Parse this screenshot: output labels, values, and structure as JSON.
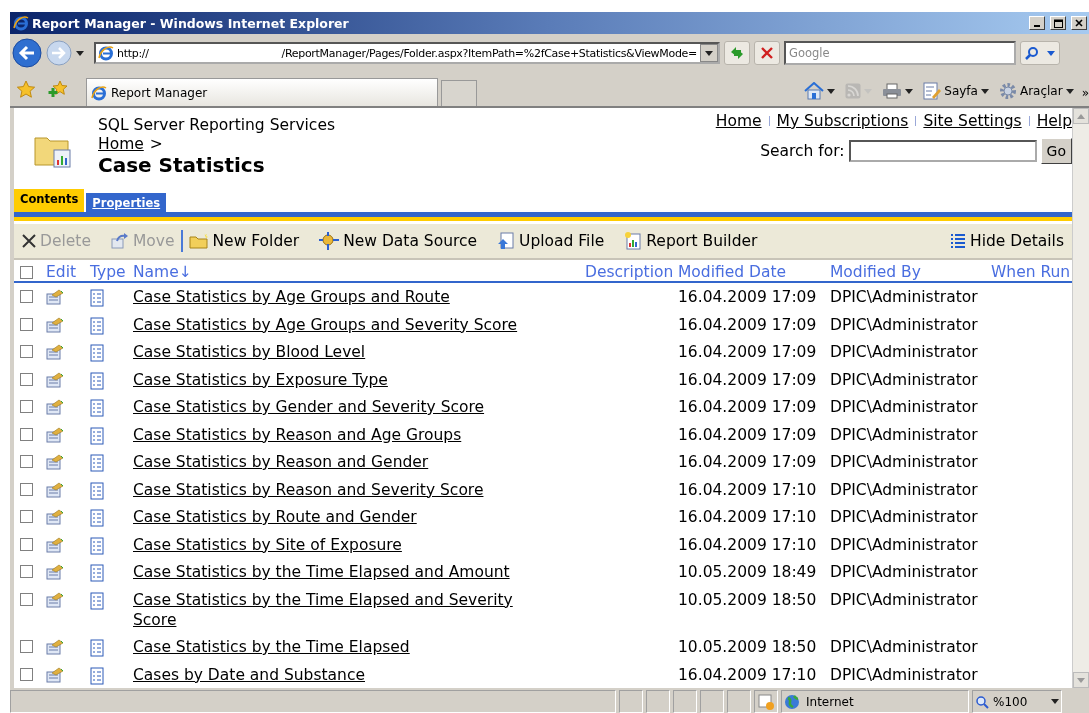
{
  "window": {
    "title": "Report Manager - Windows Internet Explorer"
  },
  "address_bar": {
    "url_scheme": "http://",
    "url_path": "/ReportManager/Pages/Folder.aspx?ItemPath=%2fCase+Statistics&ViewMode="
  },
  "search_box": {
    "placeholder": "Google"
  },
  "browser_tabs": [
    {
      "label": "Report Manager",
      "selected": true
    }
  ],
  "command_bar": [
    {
      "kind": "home"
    },
    {
      "kind": "feeds",
      "disabled": true
    },
    {
      "kind": "print"
    },
    {
      "kind": "page",
      "label": "Sayfa"
    },
    {
      "kind": "tools",
      "label": "Araçlar"
    }
  ],
  "chevron": "»",
  "page": {
    "brand": "SQL Server Reporting Services",
    "breadcrumb": {
      "link": "Home",
      "separator": ">"
    },
    "title": "Case Statistics",
    "global_links": [
      "Home",
      "My Subscriptions",
      "Site Settings",
      "Help"
    ],
    "search_label": "Search for:",
    "go_button": "Go"
  },
  "page_tabs": [
    {
      "label": "Contents",
      "selected": true
    },
    {
      "label": "Properties",
      "selected": false
    }
  ],
  "toolbar": [
    {
      "kind": "delete",
      "label": "Delete",
      "disabled": true
    },
    {
      "kind": "move",
      "label": "Move",
      "disabled": true
    },
    {
      "kind": "separator"
    },
    {
      "kind": "new-folder",
      "label": "New Folder",
      "disabled": false
    },
    {
      "kind": "data-source",
      "label": "New Data Source",
      "disabled": false
    },
    {
      "kind": "upload",
      "label": "Upload File",
      "disabled": false
    },
    {
      "kind": "builder",
      "label": "Report Builder",
      "disabled": false
    },
    {
      "kind": "details",
      "label": "Hide Details",
      "disabled": false
    }
  ],
  "table": {
    "select_all_checked": false,
    "columns": [
      "Edit",
      "Type",
      "Name↓",
      "Description",
      "Modified Date",
      "Modified By",
      "When Run"
    ],
    "rows": [
      {
        "name": "Case Statistics by Age Groups and Route",
        "modified_date": "16.04.2009 17:09",
        "modified_by": "DPIC\\Administrator",
        "checked": false
      },
      {
        "name": "Case Statistics by Age Groups and Severity Score",
        "modified_date": "16.04.2009 17:09",
        "modified_by": "DPIC\\Administrator",
        "checked": false
      },
      {
        "name": "Case Statistics by Blood Level",
        "modified_date": "16.04.2009 17:09",
        "modified_by": "DPIC\\Administrator",
        "checked": false
      },
      {
        "name": "Case Statistics by Exposure Type",
        "modified_date": "16.04.2009 17:09",
        "modified_by": "DPIC\\Administrator",
        "checked": false
      },
      {
        "name": "Case Statistics by Gender and Severity Score",
        "modified_date": "16.04.2009 17:09",
        "modified_by": "DPIC\\Administrator",
        "checked": false
      },
      {
        "name": "Case Statistics by Reason and Age Groups",
        "modified_date": "16.04.2009 17:09",
        "modified_by": "DPIC\\Administrator",
        "checked": false
      },
      {
        "name": "Case Statistics by Reason and Gender",
        "modified_date": "16.04.2009 17:09",
        "modified_by": "DPIC\\Administrator",
        "checked": false
      },
      {
        "name": "Case Statistics by Reason and Severity Score",
        "modified_date": "16.04.2009 17:10",
        "modified_by": "DPIC\\Administrator",
        "checked": false
      },
      {
        "name": "Case Statistics by Route and Gender",
        "modified_date": "16.04.2009 17:10",
        "modified_by": "DPIC\\Administrator",
        "checked": false
      },
      {
        "name": "Case Statistics by Site of Exposure",
        "modified_date": "16.04.2009 17:10",
        "modified_by": "DPIC\\Administrator",
        "checked": false
      },
      {
        "name": "Case Statistics by the Time Elapsed and Amount",
        "modified_date": "10.05.2009 18:49",
        "modified_by": "DPIC\\Administrator",
        "checked": false
      },
      {
        "name": "Case Statistics by the Time Elapsed and Severity Score",
        "modified_date": "10.05.2009 18:50",
        "modified_by": "DPIC\\Administrator",
        "checked": false
      },
      {
        "name": "Case Statistics by the Time Elapsed",
        "modified_date": "10.05.2009 18:50",
        "modified_by": "DPIC\\Administrator",
        "checked": false
      },
      {
        "name": "Cases by Date and Substance",
        "modified_date": "16.04.2009 17:10",
        "modified_by": "DPIC\\Administrator",
        "checked": false
      }
    ]
  },
  "status_bar": {
    "zone": "Internet",
    "zoom": "%100"
  }
}
